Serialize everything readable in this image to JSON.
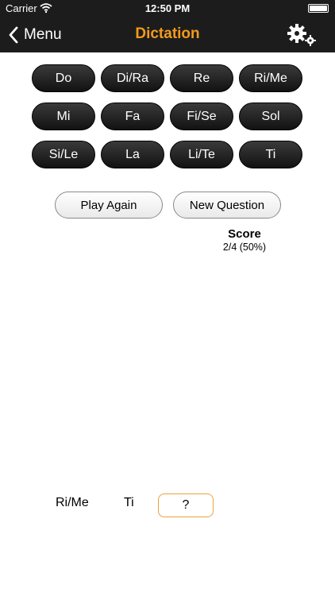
{
  "status_bar": {
    "carrier": "Carrier",
    "time": "12:50 PM"
  },
  "nav": {
    "back_label": "Menu",
    "title": "Dictation",
    "title_color": "#f39a1c"
  },
  "notes": [
    "Do",
    "Di/Ra",
    "Re",
    "Ri/Me",
    "Mi",
    "Fa",
    "Fi/Se",
    "Sol",
    "Si/Le",
    "La",
    "Li/Te",
    "Ti"
  ],
  "actions": {
    "play_again": "Play Again",
    "new_question": "New Question"
  },
  "score": {
    "title": "Score",
    "value": "2/4 (50%)"
  },
  "sequence": {
    "first": "Ri/Me",
    "second": "Ti",
    "current": "?"
  },
  "icons": {
    "back": "chevron-left-icon",
    "settings": "gears-icon",
    "wifi": "wifi-icon",
    "battery": "battery-icon"
  }
}
